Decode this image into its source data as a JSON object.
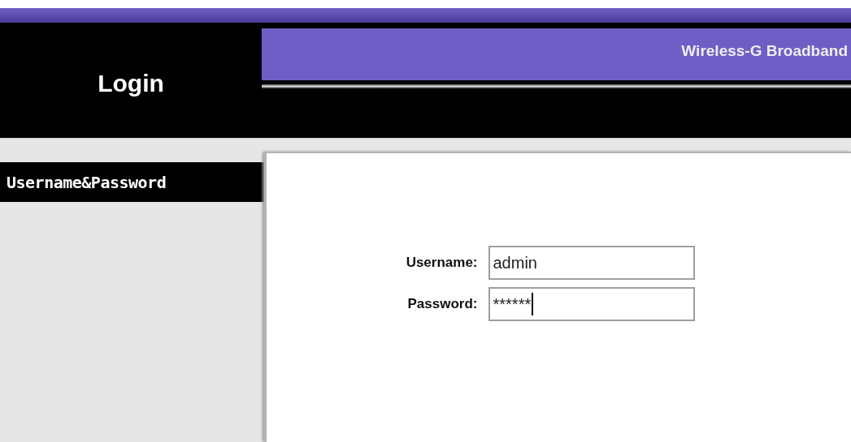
{
  "header": {
    "title": "Login",
    "product": "Wireless-G Broadband"
  },
  "sidebar": {
    "items": [
      {
        "label": "Username&Password",
        "selected": true
      }
    ]
  },
  "form": {
    "fields": [
      {
        "label": "Username:",
        "value": "admin",
        "focused": false
      },
      {
        "label": "Password:",
        "value": "******",
        "focused": true
      }
    ]
  }
}
